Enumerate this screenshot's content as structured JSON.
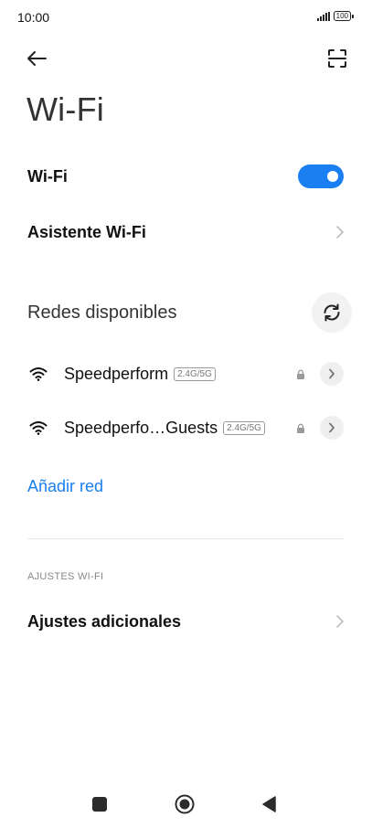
{
  "status_bar": {
    "time": "10:00",
    "battery": "100"
  },
  "header": {
    "title": "Wi-Fi"
  },
  "wifi_toggle": {
    "label": "Wi-Fi",
    "state": "on"
  },
  "assistant": {
    "label": "Asistente Wi-Fi"
  },
  "networks_section": {
    "label": "Redes disponibles"
  },
  "networks": [
    {
      "name": "Speedperform",
      "band": "2.4G/5G"
    },
    {
      "name": "Speedperfo…Guests",
      "band": "2.4G/5G"
    }
  ],
  "add_network": {
    "label": "Añadir red"
  },
  "settings_section": {
    "caption": "AJUSTES WI-FI"
  },
  "additional_settings": {
    "label": "Ajustes adicionales"
  },
  "colors": {
    "accent": "#1a7ff0",
    "text": "#111111",
    "muted": "#888888"
  }
}
